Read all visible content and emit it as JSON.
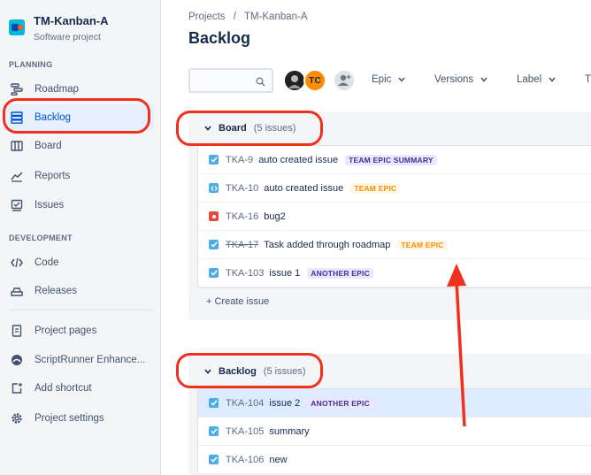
{
  "project": {
    "name": "TM-Kanban-A",
    "type": "Software project"
  },
  "sidebar": {
    "planning_label": "PLANNING",
    "development_label": "DEVELOPMENT",
    "items": [
      {
        "label": "Roadmap",
        "icon": "roadmap-icon"
      },
      {
        "label": "Backlog",
        "icon": "backlog-icon"
      },
      {
        "label": "Board",
        "icon": "board-icon"
      },
      {
        "label": "Reports",
        "icon": "reports-icon"
      },
      {
        "label": "Issues",
        "icon": "issues-icon"
      },
      {
        "label": "Code",
        "icon": "code-icon"
      },
      {
        "label": "Releases",
        "icon": "releases-icon"
      },
      {
        "label": "Project pages",
        "icon": "pages-icon"
      },
      {
        "label": "ScriptRunner Enhance...",
        "icon": "scriptrunner-icon"
      },
      {
        "label": "Add shortcut",
        "icon": "add-shortcut-icon"
      },
      {
        "label": "Project settings",
        "icon": "settings-icon"
      }
    ]
  },
  "breadcrumb": {
    "root": "Projects",
    "separator": "/",
    "project": "TM-Kanban-A"
  },
  "page_title": "Backlog",
  "toolbar": {
    "search_placeholder": "",
    "avatar_initials": "TC",
    "filters": [
      "Epic",
      "Versions",
      "Label",
      "T"
    ]
  },
  "board": {
    "title": "Board",
    "count": "(5 issues)",
    "issues": [
      {
        "key": "TKA-9",
        "summary": "auto created issue",
        "epic": "TEAM EPIC SUMMARY",
        "epic_color": "purple",
        "type": "task",
        "done": false
      },
      {
        "key": "TKA-10",
        "summary": "auto created issue",
        "epic": "TEAM EPIC",
        "epic_color": "orange",
        "type": "subtask",
        "done": false
      },
      {
        "key": "TKA-16",
        "summary": "bug2",
        "epic": "",
        "epic_color": "",
        "type": "bug",
        "done": false
      },
      {
        "key": "TKA-17",
        "summary": "Task added through roadmap",
        "epic": "TEAM EPIC",
        "epic_color": "orange",
        "type": "task",
        "done": true
      },
      {
        "key": "TKA-103",
        "summary": "issue 1",
        "epic": "ANOTHER EPIC",
        "epic_color": "purple",
        "type": "task",
        "done": false
      }
    ],
    "create_label": "+ Create issue"
  },
  "backlog": {
    "title": "Backlog",
    "count": "(5 issues)",
    "issues": [
      {
        "key": "TKA-104",
        "summary": "issue 2",
        "epic": "ANOTHER EPIC",
        "epic_color": "purple",
        "type": "task",
        "done": false,
        "selected": true
      },
      {
        "key": "TKA-105",
        "summary": "summary",
        "epic": "",
        "epic_color": "",
        "type": "task",
        "done": false
      },
      {
        "key": "TKA-106",
        "summary": "new",
        "epic": "",
        "epic_color": "",
        "type": "task",
        "done": false
      }
    ]
  },
  "colors": {
    "accent": "#0052CC",
    "annotation": "#F0301E",
    "task": "#4BADE8",
    "bug": "#E5493A",
    "subtask": "#4BADE8"
  }
}
